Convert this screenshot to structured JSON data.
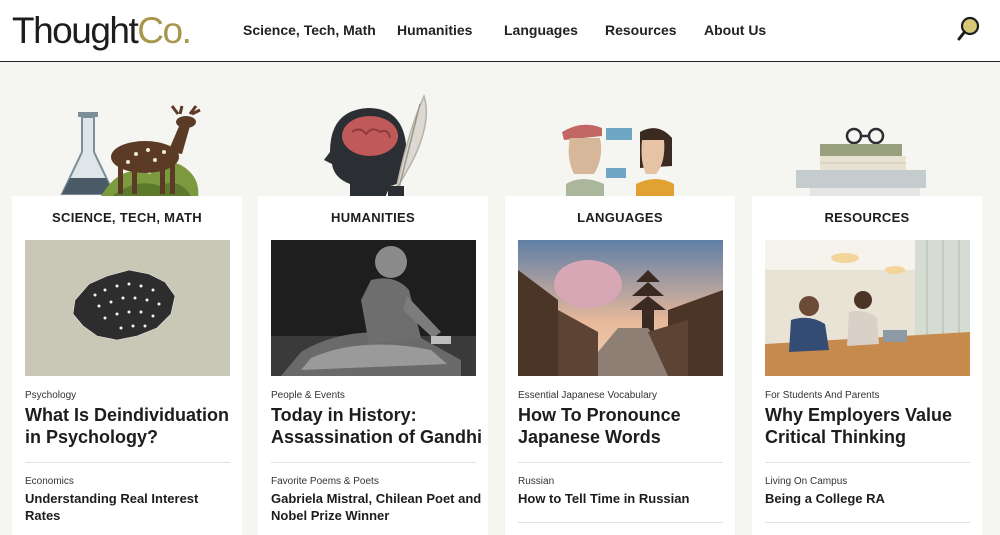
{
  "header": {
    "logo_part1": "Thought",
    "logo_part2": "Co.",
    "nav": [
      "Science, Tech, Math",
      "Humanities",
      "Languages",
      "Resources",
      "About Us"
    ]
  },
  "colors": {
    "accent": "#a8964e",
    "background": "#f5f5f1",
    "card": "#ffffff",
    "text": "#1d1d1d"
  },
  "icons": {
    "search": "magnifier-icon"
  },
  "cards": [
    {
      "title": "SCIENCE, TECH, MATH",
      "illustration": "flask-and-deer",
      "image": "crowd-of-figures",
      "cat1": "Psychology",
      "headline1": "What Is Deindividuation in Psychology?",
      "cat2": "Economics",
      "headline2": "Understanding Real Interest Rates"
    },
    {
      "title": "HUMANITIES",
      "illustration": "head-and-quill",
      "image": "gandhi-photo",
      "cat1": "People & Events",
      "headline1": "Today in History: Assassination of Gandhi",
      "cat2": "Favorite Poems & Poets",
      "headline2": "Gabriela Mistral, Chilean Poet and Nobel Prize Winner"
    },
    {
      "title": "LANGUAGES",
      "illustration": "two-people-talking",
      "image": "kyoto-pagoda-street",
      "cat1": "Essential Japanese Vocabulary",
      "headline1": "How To Pronounce Japanese Words",
      "cat2": "Russian",
      "headline2": "How to Tell Time in Russian"
    },
    {
      "title": "RESOURCES",
      "illustration": "books-and-glasses",
      "image": "office-meeting",
      "cat1": "For Students And Parents",
      "headline1": "Why Employers Value Critical Thinking",
      "cat2": "Living On Campus",
      "headline2": "Being a College RA"
    }
  ]
}
